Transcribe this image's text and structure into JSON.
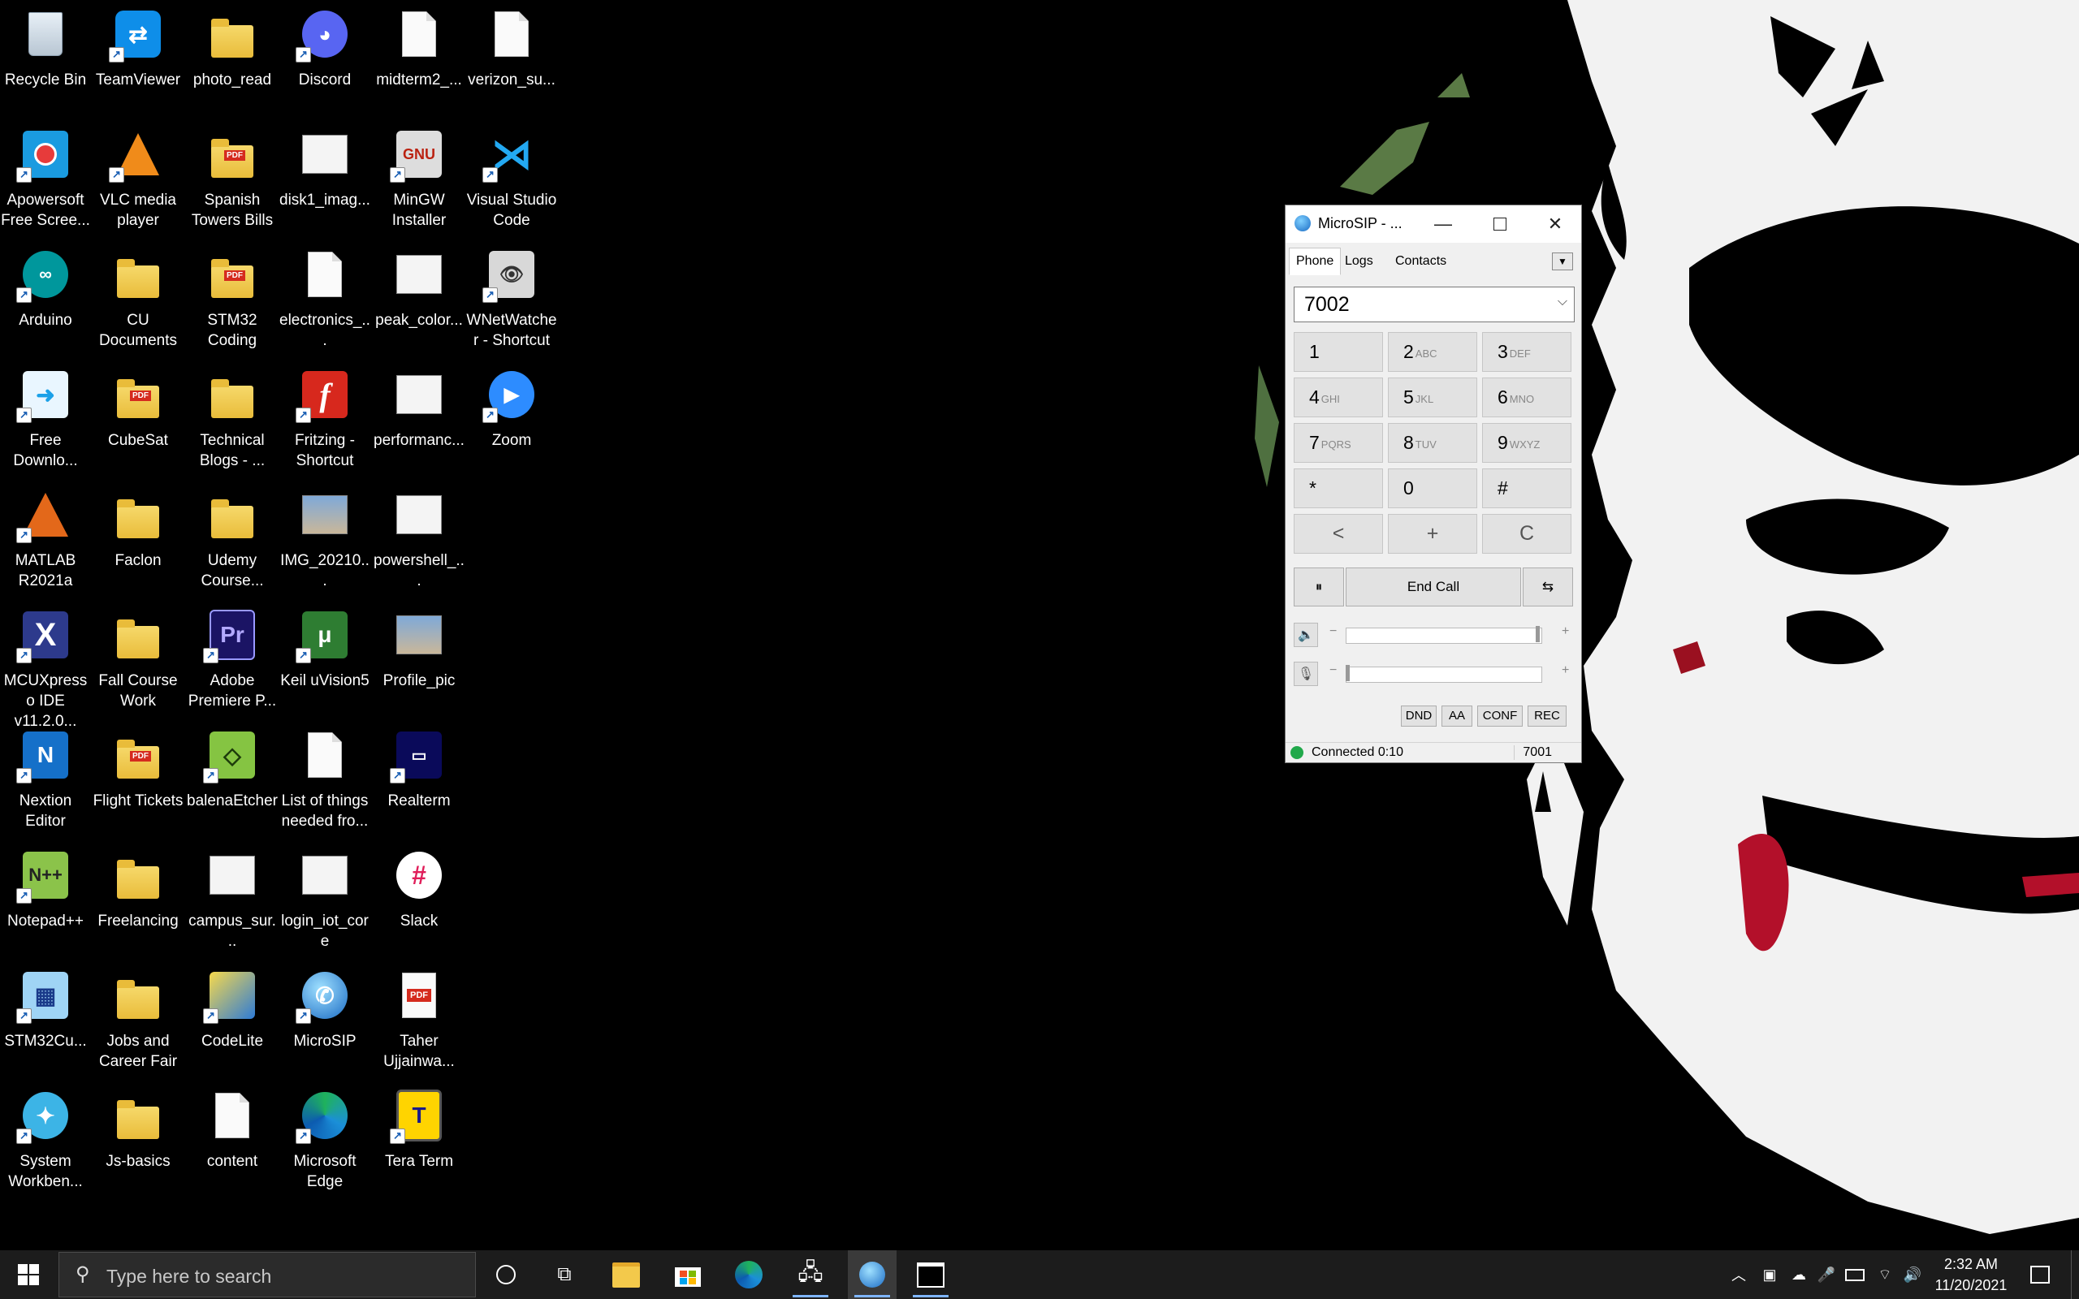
{
  "desktop": {
    "icons": [
      {
        "label": "Recycle Bin",
        "icon": "recycle-bin-icon"
      },
      {
        "label": "TeamViewer",
        "icon": "teamviewer-icon"
      },
      {
        "label": "photo_read",
        "icon": "folder-icon"
      },
      {
        "label": "Discord",
        "icon": "discord-icon"
      },
      {
        "label": "midterm2_...",
        "icon": "document-icon"
      },
      {
        "label": "verizon_su...",
        "icon": "document-icon"
      },
      {
        "label": "Apowersoft Free Scree...",
        "icon": "apowersoft-icon"
      },
      {
        "label": "VLC media player",
        "icon": "vlc-icon"
      },
      {
        "label": "Spanish Towers Bills",
        "icon": "pdf-folder-icon"
      },
      {
        "label": "disk1_imag...",
        "icon": "image-file-icon"
      },
      {
        "label": "MinGW Installer",
        "icon": "mingw-icon"
      },
      {
        "label": "Visual Studio Code",
        "icon": "vscode-icon"
      },
      {
        "label": "Arduino",
        "icon": "arduino-icon"
      },
      {
        "label": "CU Documents",
        "icon": "folder-icon"
      },
      {
        "label": "STM32 Coding",
        "icon": "pdf-folder-icon"
      },
      {
        "label": "electronics_...",
        "icon": "document-icon"
      },
      {
        "label": "peak_color...",
        "icon": "image-file-icon"
      },
      {
        "label": "WNetWatcher - Shortcut",
        "icon": "wnetwatcher-icon"
      },
      {
        "label": "Free Downlo...",
        "icon": "free-download-icon"
      },
      {
        "label": "CubeSat",
        "icon": "pdf-folder-icon"
      },
      {
        "label": "Technical Blogs - ...",
        "icon": "folder-icon"
      },
      {
        "label": "Fritzing - Shortcut",
        "icon": "fritzing-icon"
      },
      {
        "label": "performanc...",
        "icon": "image-file-icon"
      },
      {
        "label": "Zoom",
        "icon": "zoom-icon"
      },
      {
        "label": "MATLAB R2021a",
        "icon": "matlab-icon"
      },
      {
        "label": "Faclon",
        "icon": "folder-icon"
      },
      {
        "label": "Udemy Course...",
        "icon": "folder-icon"
      },
      {
        "label": "IMG_20210...",
        "icon": "photo-icon"
      },
      {
        "label": "powershell_...",
        "icon": "image-file-icon"
      },
      {
        "label": "MCUXpresso IDE v11.2.0...",
        "icon": "mcuxpresso-icon"
      },
      {
        "label": "Fall Course Work",
        "icon": "folder-icon"
      },
      {
        "label": "Adobe Premiere P...",
        "icon": "premiere-icon"
      },
      {
        "label": "Keil uVision5",
        "icon": "keil-icon"
      },
      {
        "label": "Profile_pic",
        "icon": "photo-icon"
      },
      {
        "label": "Nextion Editor",
        "icon": "nextion-icon"
      },
      {
        "label": "Flight Tickets",
        "icon": "pdf-folder-icon"
      },
      {
        "label": "balenaEtcher",
        "icon": "balena-icon"
      },
      {
        "label": "List of things needed fro...",
        "icon": "document-icon"
      },
      {
        "label": "Realterm",
        "icon": "realterm-icon"
      },
      {
        "label": "Notepad++",
        "icon": "notepadpp-icon"
      },
      {
        "label": "Freelancing",
        "icon": "folder-icon"
      },
      {
        "label": "campus_sur...",
        "icon": "image-file-icon"
      },
      {
        "label": "login_iot_core",
        "icon": "image-file-icon"
      },
      {
        "label": "Slack",
        "icon": "slack-icon"
      },
      {
        "label": "STM32Cu...",
        "icon": "stm32cube-icon"
      },
      {
        "label": "Jobs and Career Fair",
        "icon": "folder-icon"
      },
      {
        "label": "CodeLite",
        "icon": "codelite-icon"
      },
      {
        "label": "MicroSIP",
        "icon": "microsip-icon"
      },
      {
        "label": "Taher Ujjainwa...",
        "icon": "pdf-icon"
      },
      {
        "label": "System Workben...",
        "icon": "system-workbench-icon"
      },
      {
        "label": "Js-basics",
        "icon": "folder-icon"
      },
      {
        "label": "content",
        "icon": "document-icon"
      },
      {
        "label": "Microsoft Edge",
        "icon": "edge-icon"
      },
      {
        "label": "Tera Term",
        "icon": "teraterm-icon"
      }
    ]
  },
  "microsip": {
    "title": "MicroSIP - ...",
    "tabs": [
      "Phone",
      "Logs",
      "Contacts"
    ],
    "number_value": "7002",
    "keypad": [
      {
        "digit": "1",
        "letters": ""
      },
      {
        "digit": "2",
        "letters": "ABC"
      },
      {
        "digit": "3",
        "letters": "DEF"
      },
      {
        "digit": "4",
        "letters": "GHI"
      },
      {
        "digit": "5",
        "letters": "JKL"
      },
      {
        "digit": "6",
        "letters": "MNO"
      },
      {
        "digit": "7",
        "letters": "PQRS"
      },
      {
        "digit": "8",
        "letters": "TUV"
      },
      {
        "digit": "9",
        "letters": "WXYZ"
      },
      {
        "digit": "*",
        "letters": ""
      },
      {
        "digit": "0",
        "letters": ""
      },
      {
        "digit": "#",
        "letters": ""
      },
      {
        "digit": "<",
        "letters": ""
      },
      {
        "digit": "+",
        "letters": ""
      },
      {
        "digit": "C",
        "letters": ""
      }
    ],
    "hold_symbol": "⏸",
    "end_call_label": "End Call",
    "transfer_symbol": "⇆",
    "minus": "−",
    "plus": "+",
    "buttons": [
      "DND",
      "AA",
      "CONF",
      "REC"
    ],
    "status_text": "Connected 0:10",
    "status_ext": "7001",
    "speaker_level": 1.0,
    "mic_level": 0.0
  },
  "taskbar": {
    "search_placeholder": "Type here to search",
    "time": "2:32 AM",
    "date": "11/20/2021"
  },
  "colors": {
    "wallpaper_bg": "#000000",
    "taskbar_bg": "#1c1c1c",
    "accent": "#0078d4",
    "status_green": "#20a84a"
  }
}
